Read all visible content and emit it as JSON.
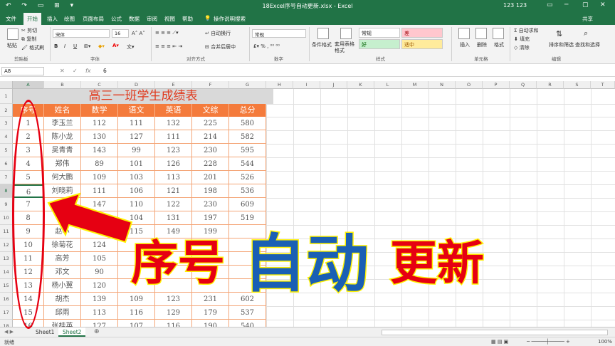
{
  "titlebar": {
    "quick_access": "↶ ↷ ▭ ⊞ ▾",
    "window_title": "18Excel序号自动更新.xlsx - Excel",
    "user": "123 123",
    "controls": [
      "▭",
      "─",
      "▢",
      "✕"
    ]
  },
  "tabs": [
    "文件",
    "开始",
    "插入",
    "绘图",
    "页面布局",
    "公式",
    "数据",
    "审阅",
    "视图",
    "帮助"
  ],
  "tell_me": "操作说明搜索",
  "share": "共享",
  "ribbon": {
    "clipboard": {
      "cut": "剪切",
      "copy": "复制",
      "format_painter": "格式刷",
      "paste": "粘贴",
      "group": "剪贴板"
    },
    "font": {
      "name": "宋体",
      "size": "16",
      "bold": "B",
      "italic": "I",
      "underline": "U",
      "group": "字体"
    },
    "alignment": {
      "wrap": "自动换行",
      "merge": "合并后居中",
      "group": "对齐方式"
    },
    "number": {
      "format": "常规",
      "group": "数字"
    },
    "styles": {
      "conditional": "条件格式",
      "table": "套用表格格式",
      "normal": "常规",
      "bad": "差",
      "good": "好",
      "neutral": "适中",
      "group": "样式"
    },
    "cells": {
      "insert": "插入",
      "delete": "删除",
      "format": "格式",
      "group": "单元格"
    },
    "editing": {
      "autosum": "自动求和",
      "fill": "填充",
      "clear": "清除",
      "sort": "排序和筛选",
      "find": "查找和选择",
      "group": "编辑"
    }
  },
  "formula_bar": {
    "name_box": "A8",
    "fx": "fx",
    "value": "6"
  },
  "columns": [
    "A",
    "B",
    "C",
    "D",
    "E",
    "F",
    "G",
    "H",
    "I",
    "J",
    "K",
    "L",
    "M",
    "N",
    "O",
    "P",
    "Q",
    "R",
    "S",
    "T"
  ],
  "rows": [
    "1",
    "2",
    "3",
    "4",
    "5",
    "6",
    "7",
    "8",
    "9",
    "10",
    "11",
    "12",
    "13",
    "14",
    "15",
    "16",
    "17",
    "18"
  ],
  "table": {
    "title": "高三一班学生成绩表",
    "headers": [
      "序号",
      "姓名",
      "数学",
      "语文",
      "英语",
      "文综",
      "总分"
    ],
    "rows": [
      [
        "1",
        "李玉兰",
        "112",
        "111",
        "132",
        "225",
        "580"
      ],
      [
        "2",
        "陈小龙",
        "130",
        "127",
        "111",
        "214",
        "582"
      ],
      [
        "3",
        "吴青青",
        "143",
        "99",
        "123",
        "230",
        "595"
      ],
      [
        "4",
        "郑伟",
        "89",
        "101",
        "126",
        "228",
        "544"
      ],
      [
        "5",
        "何大鹏",
        "109",
        "103",
        "113",
        "201",
        "526"
      ],
      [
        "6",
        "刘晓莉",
        "111",
        "106",
        "121",
        "198",
        "536"
      ],
      [
        "7",
        "",
        "147",
        "110",
        "122",
        "230",
        "609"
      ],
      [
        "8",
        "",
        "",
        "104",
        "131",
        "197",
        "519"
      ],
      [
        "9",
        "赵小",
        "",
        "115",
        "149",
        "199",
        ""
      ],
      [
        "10",
        "徐菊花",
        "124",
        "",
        "",
        "",
        ""
      ],
      [
        "11",
        "高芳",
        "105",
        "",
        "",
        "",
        ""
      ],
      [
        "12",
        "邓文",
        "90",
        "",
        "",
        "",
        ""
      ],
      [
        "13",
        "杨小翼",
        "120",
        "",
        "",
        "",
        ""
      ],
      [
        "14",
        "胡杰",
        "139",
        "109",
        "123",
        "231",
        "602"
      ],
      [
        "15",
        "邱雨",
        "113",
        "116",
        "129",
        "179",
        "537"
      ],
      [
        "16",
        "张桂英",
        "127",
        "107",
        "116",
        "190",
        "540"
      ]
    ]
  },
  "sheets": [
    "Sheet1",
    "Sheet2"
  ],
  "add_sheet": "⊕",
  "status": {
    "ready": "就绪",
    "zoom": "100%"
  },
  "overlay": {
    "part1": "序号",
    "part2": "自动",
    "part3": "更新"
  },
  "colors": {
    "excel_green": "#217346",
    "header_orange": "#f47b3c",
    "overlay_red": "#e60012",
    "overlay_blue": "#1a5fb4",
    "outline_yellow": "#fff200"
  }
}
